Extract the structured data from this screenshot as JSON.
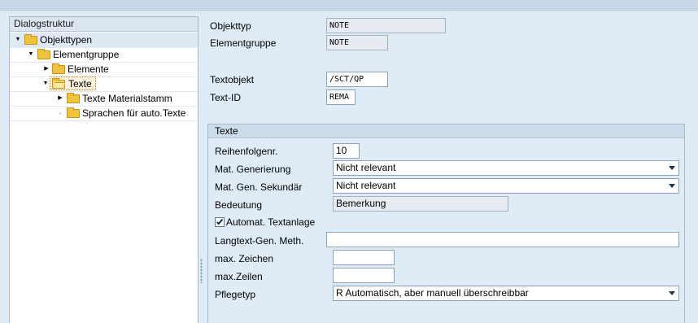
{
  "tree": {
    "header": "Dialogstruktur",
    "nodes": [
      {
        "label": "Objekttypen"
      },
      {
        "label": "Elementgruppe"
      },
      {
        "label": "Elemente"
      },
      {
        "label": "Texte"
      },
      {
        "label": "Texte Materialstamm"
      },
      {
        "label": "Sprachen für auto.Texte"
      }
    ]
  },
  "header_fields": {
    "objekttyp": {
      "label": "Objekttyp",
      "value": "NOTE"
    },
    "elementgruppe": {
      "label": "Elementgruppe",
      "value": "NOTE"
    },
    "textobjekt": {
      "label": "Textobjekt",
      "value": "/SCT/QP"
    },
    "text_id": {
      "label": "Text-ID",
      "value": "REMA"
    }
  },
  "texte": {
    "title": "Texte",
    "reihenfolge": {
      "label": "Reihenfolgenr.",
      "value": "10"
    },
    "mat_generierung": {
      "label": "Mat. Generierung",
      "value": "Nicht relevant"
    },
    "mat_gen_sekundaer": {
      "label": "Mat. Gen. Sekundär",
      "value": "Nicht relevant"
    },
    "bedeutung": {
      "label": "Bedeutung",
      "value": "Bemerkung"
    },
    "automat_textanlage": {
      "label": "Automat. Textanlage",
      "checked": true
    },
    "langtext_gen": {
      "label": "Langtext-Gen. Meth.",
      "value": ""
    },
    "max_zeichen": {
      "label": "max. Zeichen",
      "value": ""
    },
    "max_zeilen": {
      "label": "max.Zeilen",
      "value": ""
    },
    "pflegetyp": {
      "label": "Pflegetyp",
      "value": "R Automatisch, aber manuell überschreibbar"
    }
  },
  "colors": {
    "background": "#dfebf5",
    "selection_border": "#c77a22",
    "folder": "#f0c33c"
  },
  "icons": [
    "folder-icon",
    "folder-open-icon",
    "expand-arrow-icon",
    "collapse-arrow-icon",
    "dropdown-arrow-icon",
    "checkmark-icon"
  ]
}
